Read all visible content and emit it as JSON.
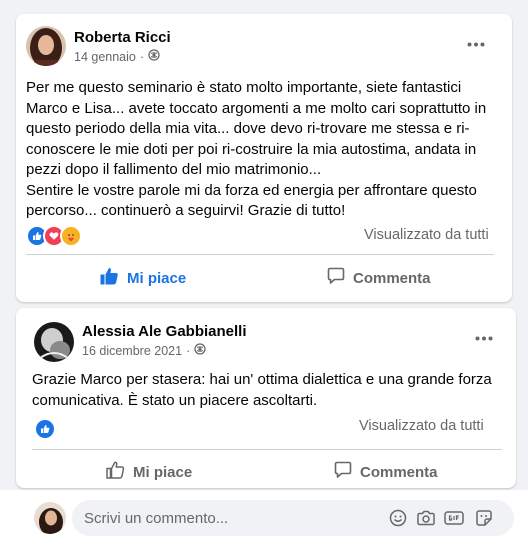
{
  "posts": [
    {
      "author": "Roberta Ricci",
      "date": "14 gennaio",
      "separator": "·",
      "body": [
        "Per me questo seminario è stato molto importante, siete fantastici Marco e Lisa... avete toccato argomenti a me molto cari soprattutto in questo periodo della mia vita... dove devo ri-trovare me stessa e ri-conoscere le mie doti per poi ri-costruire la mia autostima, andata in pezzi dopo il fallimento del mio matrimonio...",
        "Sentire le vostre parole mi da forza ed energia per affrontare questo percorso... continuerò a seguirvi! Grazie di tutto!"
      ],
      "reactions": [
        "like-reaction",
        "love-reaction",
        "care-reaction"
      ],
      "seen_label": "Visualizzato da tutti",
      "like_label": "Mi piace",
      "comment_label": "Commenta"
    },
    {
      "author": "Alessia Ale Gabbianelli",
      "date": "16 dicembre 2021",
      "separator": "·",
      "body": [
        "Grazie Marco per stasera: hai un' ottima dialettica e una grande forza comunicativa. È stato un piacere ascoltarti."
      ],
      "reactions": [
        "like-reaction"
      ],
      "seen_label": "Visualizzato da tutti",
      "like_label": "Mi piace",
      "comment_label": "Commenta"
    }
  ],
  "comment_bar": {
    "placeholder": "Scrivi un commento...",
    "icons": [
      "emoji-icon",
      "camera-icon",
      "gif-icon",
      "sticker-icon"
    ]
  },
  "colors": {
    "accent": "#1b74e4",
    "muted": "#65676b",
    "background": "#f0f2f5",
    "love": "#f33e58",
    "care": "#f7b125"
  }
}
